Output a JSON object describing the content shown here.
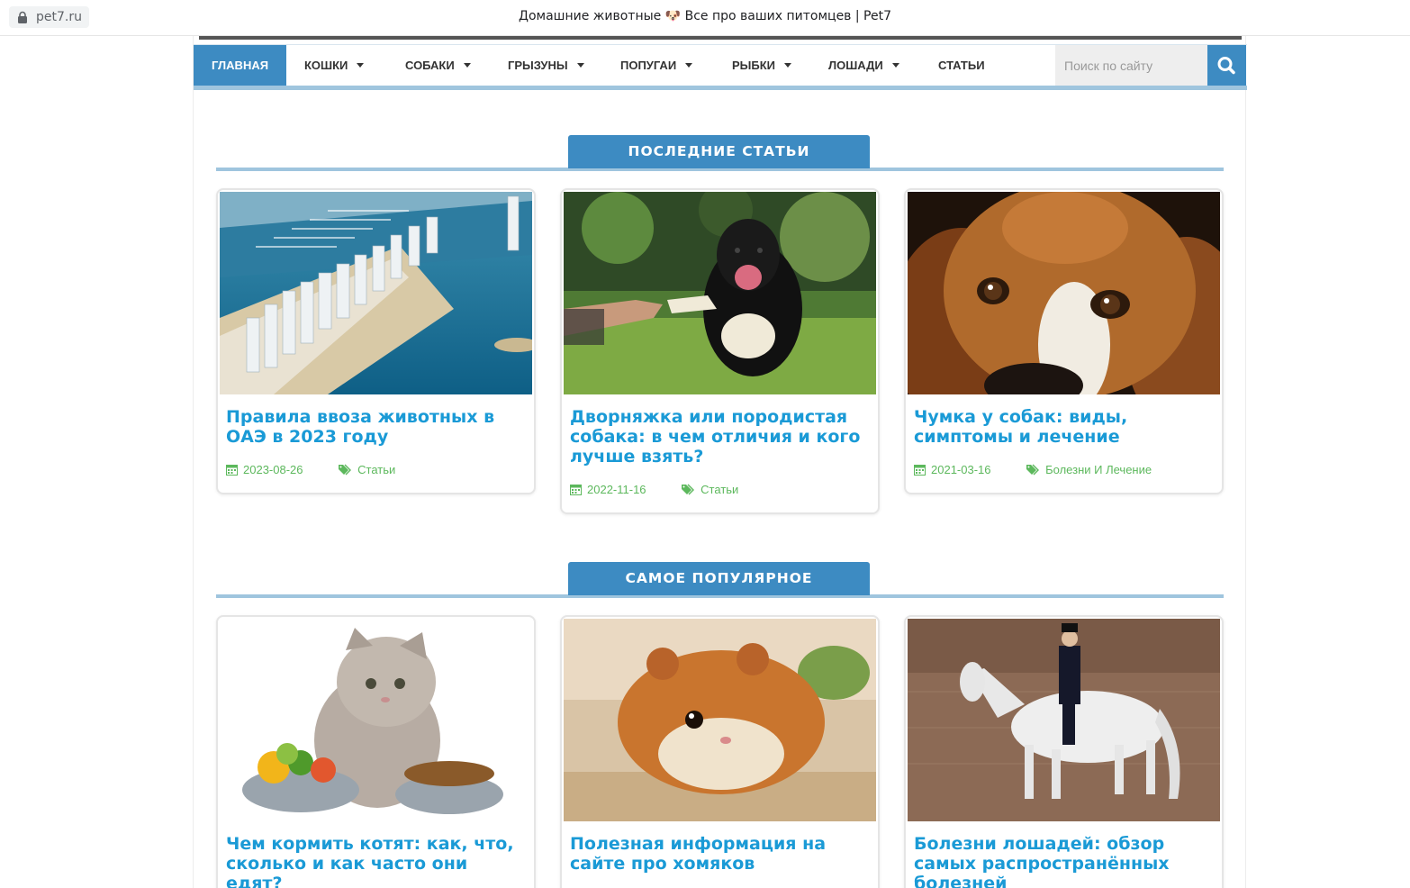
{
  "browser": {
    "url": "pet7.ru",
    "tab_title": "Домашние животные 🐶 Все про ваших питомцев | Pet7"
  },
  "nav": {
    "items": [
      {
        "label": "Главная",
        "active": true
      },
      {
        "label": "Кошки",
        "dropdown": true
      },
      {
        "label": "Собаки",
        "dropdown": true
      },
      {
        "label": "Грызуны",
        "dropdown": true
      },
      {
        "label": "Попугаи",
        "dropdown": true
      },
      {
        "label": "Рыбки",
        "dropdown": true
      },
      {
        "label": "Лошади",
        "dropdown": true
      },
      {
        "label": "Статьи"
      }
    ],
    "search_placeholder": "Поиск по сайту"
  },
  "latest": {
    "heading": "ПОСЛЕДНИЕ СТАТЬИ",
    "cards": [
      {
        "title": "Правила ввоза животных в ОАЭ в 2023 году",
        "date": "2023-08-26",
        "category": "Статьи",
        "image": "dubai-marina-photo"
      },
      {
        "title": "Дворняжка или породистая собака: в чем отличия и кого лучше взять?",
        "date": "2022-11-16",
        "category": "Статьи",
        "image": "black-dog-paw-photo"
      },
      {
        "title": "Чумка у собак: виды, симптомы и лечение",
        "date": "2021-03-16",
        "category": "Болезни И Лечение",
        "image": "beagle-face-photo"
      }
    ]
  },
  "popular": {
    "heading": "САМОЕ ПОПУЛЯРНОЕ",
    "cards": [
      {
        "title": "Чем кормить котят: как, что, сколько и как часто они едят?",
        "image": "kitten-food-bowls-photo"
      },
      {
        "title": "Полезная информация на сайте про хомяков",
        "image": "hamster-photo"
      },
      {
        "title": "Болезни лошадей: обзор самых распространённых болезней",
        "image": "dressage-horse-photo"
      }
    ]
  },
  "colors": {
    "accent": "#3d8bc2",
    "accent_light": "#9fc5de",
    "link": "#1a9ad6",
    "meta": "#5cb85c"
  }
}
